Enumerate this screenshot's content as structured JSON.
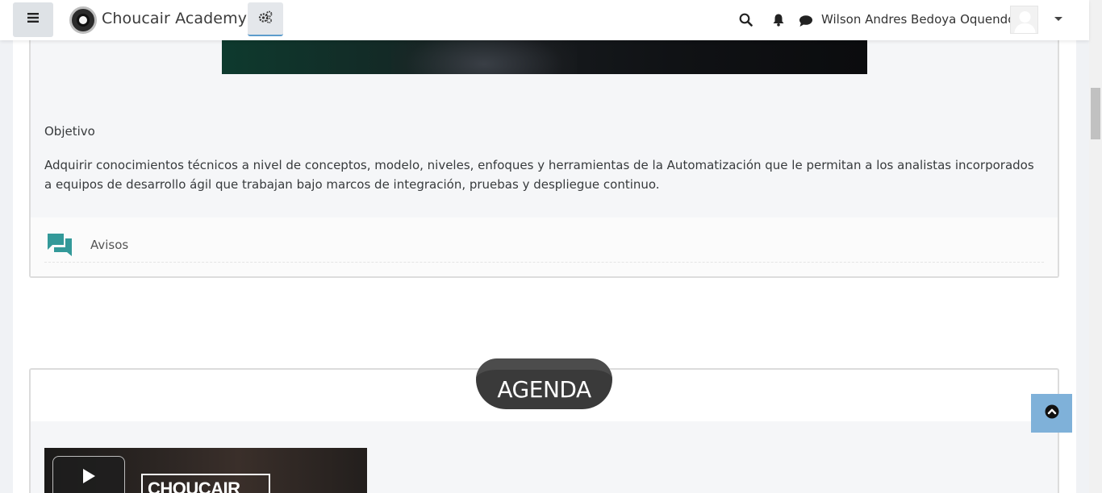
{
  "navbar": {
    "site_name": "Choucair Academy",
    "user_name": "Wilson Andres Bedoya Oquendo",
    "icons": [
      "menu-icon",
      "cogs-icon",
      "search-icon",
      "bell-icon",
      "comment-icon",
      "chevron-down-icon"
    ]
  },
  "section1": {
    "objective_title": "Objetivo",
    "objective_text": "Adquirir conocimientos técnicos a nivel de conceptos, modelo, niveles, enfoques y herramientas de la Automatización que le permitan a los analistas incorporados a equipos de desarrollo ágil que trabajan bajo marcos de integración, pruebas y despliegue continuo.",
    "activity_label": "Avisos"
  },
  "section2": {
    "title": "AGENDA",
    "video_brand": "CHOUCAIR"
  },
  "colors": {
    "accent_teal": "#3a9a9a",
    "agenda_pill": "#3a3a3a",
    "back_to_top": "#7fb1d9"
  }
}
